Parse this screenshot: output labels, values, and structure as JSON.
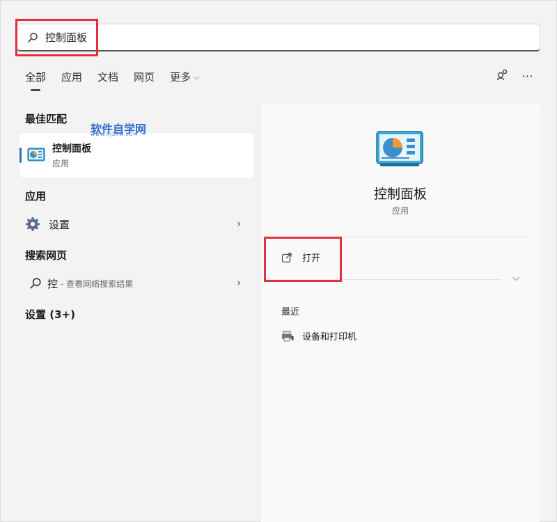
{
  "search": {
    "query": "控制面板"
  },
  "tabs": [
    "全部",
    "应用",
    "文档",
    "网页",
    "更多"
  ],
  "watermark": {
    "title": "软件自学网",
    "url": "WWW.RJZXW.COM"
  },
  "left": {
    "best_match_title": "最佳匹配",
    "best_match": {
      "name": "控制面板",
      "type": "应用"
    },
    "apps_title": "应用",
    "apps": [
      {
        "label": "设置"
      }
    ],
    "web_title": "搜索网页",
    "web_item": {
      "query": "控",
      "hint": "- 查看网络搜索结果"
    },
    "settings_title": "设置 (3+)"
  },
  "right": {
    "title": "控制面板",
    "subtitle": "应用",
    "open_label": "打开",
    "recent_title": "最近",
    "recent_items": [
      {
        "label": "设备和打印机"
      }
    ]
  },
  "colors": {
    "highlight": "#e0313c",
    "accent": "#3a6fb0",
    "watermark": "#2f6fd1"
  }
}
